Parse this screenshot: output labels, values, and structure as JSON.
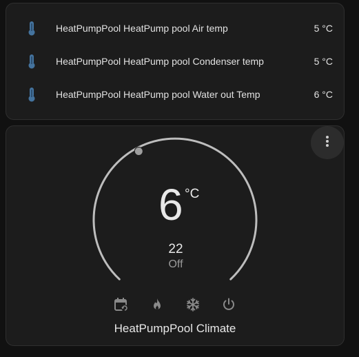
{
  "entities": [
    {
      "name": "HeatPumpPool HeatPump pool Air temp",
      "state": "5 °C",
      "icon": "thermometer-icon"
    },
    {
      "name": "HeatPumpPool HeatPump pool Condenser temp",
      "state": "5 °C",
      "icon": "thermometer-icon"
    },
    {
      "name": "HeatPumpPool HeatPump pool Water out Temp",
      "state": "6 °C",
      "icon": "thermometer-icon"
    }
  ],
  "thermostat": {
    "current_temp": "6",
    "unit": "°C",
    "target_temp": "22",
    "hvac_mode": "Off",
    "title": "HeatPumpPool Climate",
    "mode_icons": [
      "calendar-sync-icon",
      "fire-icon",
      "snowflake-icon",
      "power-icon"
    ],
    "menu_icon": "dots-vertical-icon"
  },
  "colors": {
    "background": "#111111",
    "card": "#1c1c1c",
    "icon_blue": "#44739e",
    "text": "#e1e1e1",
    "secondary_text": "#9a9a9a",
    "dial_track": "#bdbdbd"
  }
}
